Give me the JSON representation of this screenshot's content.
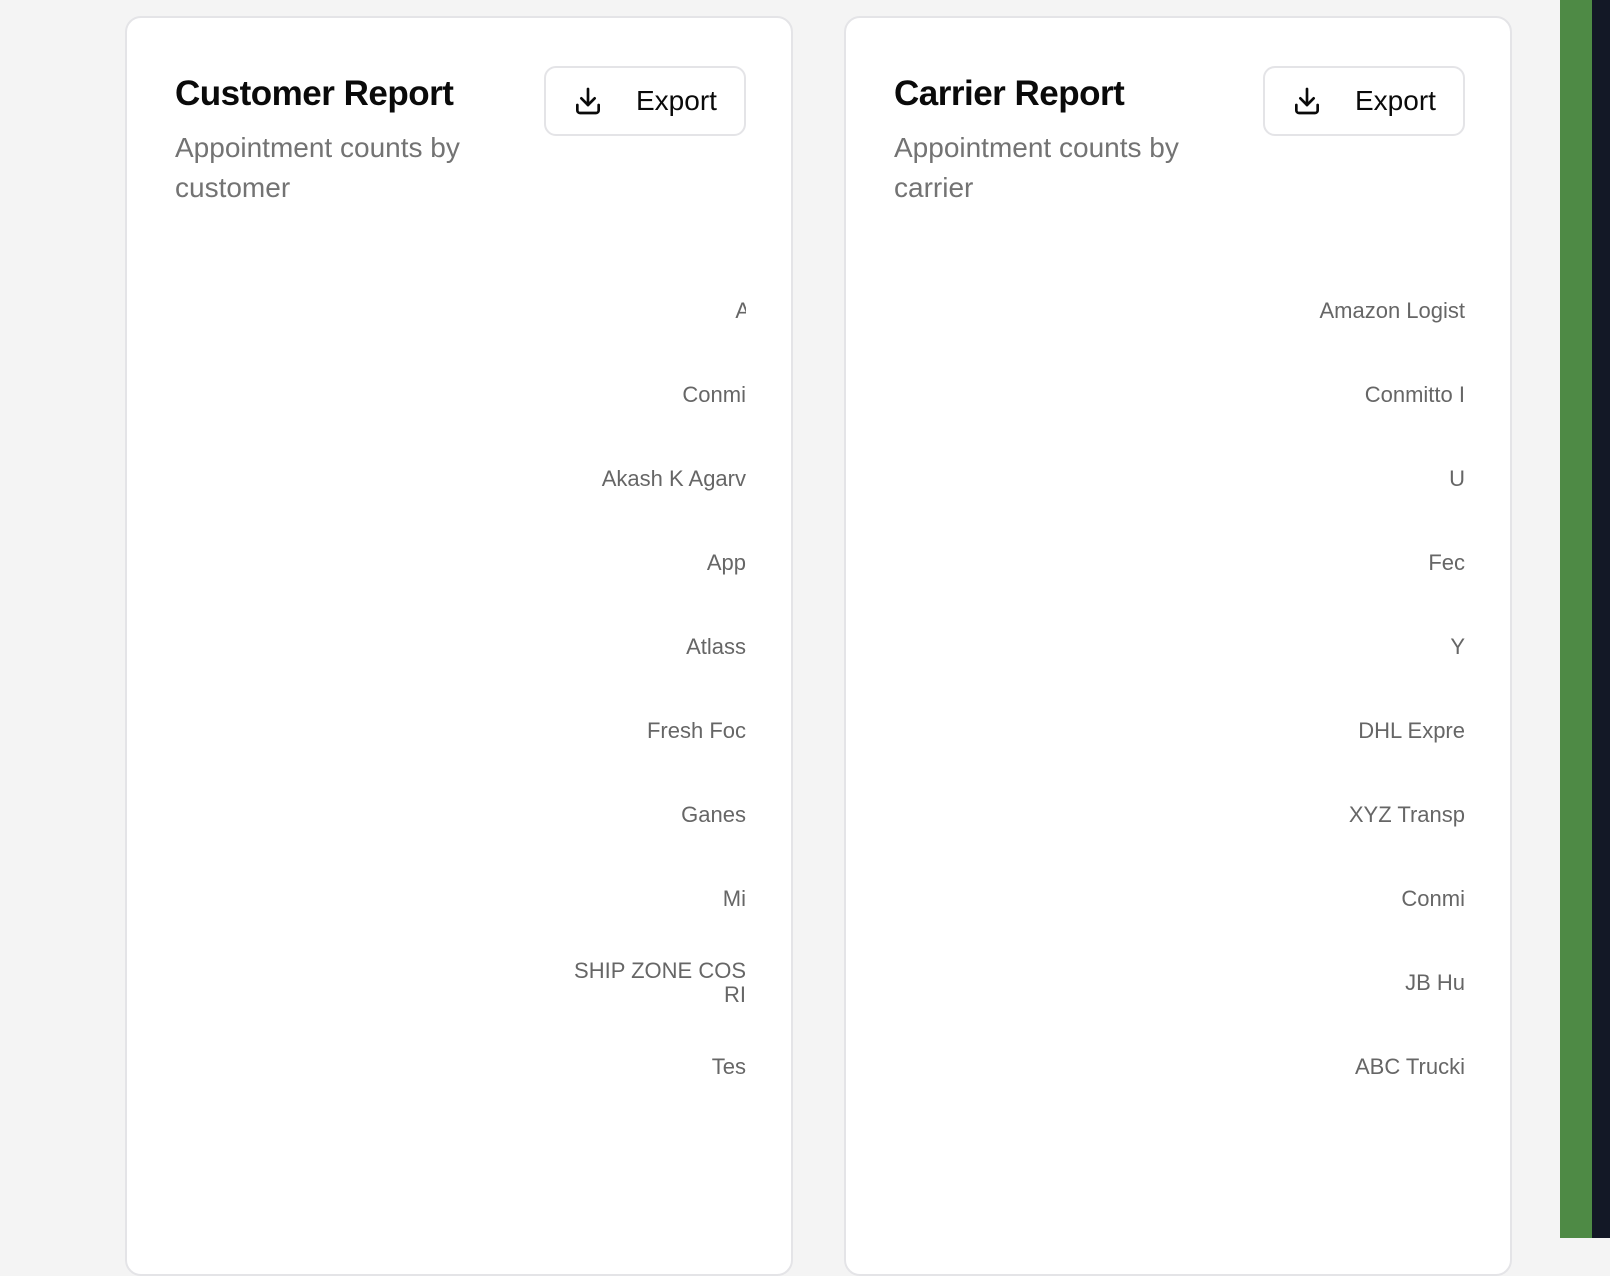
{
  "customer_report": {
    "title": "Customer Report",
    "subtitle": "Appointment counts by customer",
    "export_label": "Export",
    "axis_labels": [
      "A",
      "Conmi",
      "Akash K Agarv",
      "App",
      "Atlass",
      "Fresh Foc",
      "Ganes",
      "Mi",
      "SHIP ZONE COS",
      "RI",
      "Tes"
    ]
  },
  "carrier_report": {
    "title": "Carrier Report",
    "subtitle": "Appointment counts by carrier",
    "export_label": "Export",
    "axis_labels": [
      "Amazon Logist",
      "Conmitto I",
      "U",
      "Fec",
      "Y",
      "DHL Expre",
      "XYZ Transp",
      "Conmi",
      "JB Hu",
      "ABC Trucki"
    ]
  },
  "colors": {
    "page_background": "#f4f4f4",
    "card_background": "#ffffff",
    "card_border": "#e4e4e7",
    "title_text": "#0a0a0a",
    "subtitle_text": "#737373",
    "axis_label_text": "#666666",
    "sidebar_green": "#4e8a45",
    "sidebar_dark": "#131826"
  },
  "icons": {
    "export": "download-icon"
  }
}
